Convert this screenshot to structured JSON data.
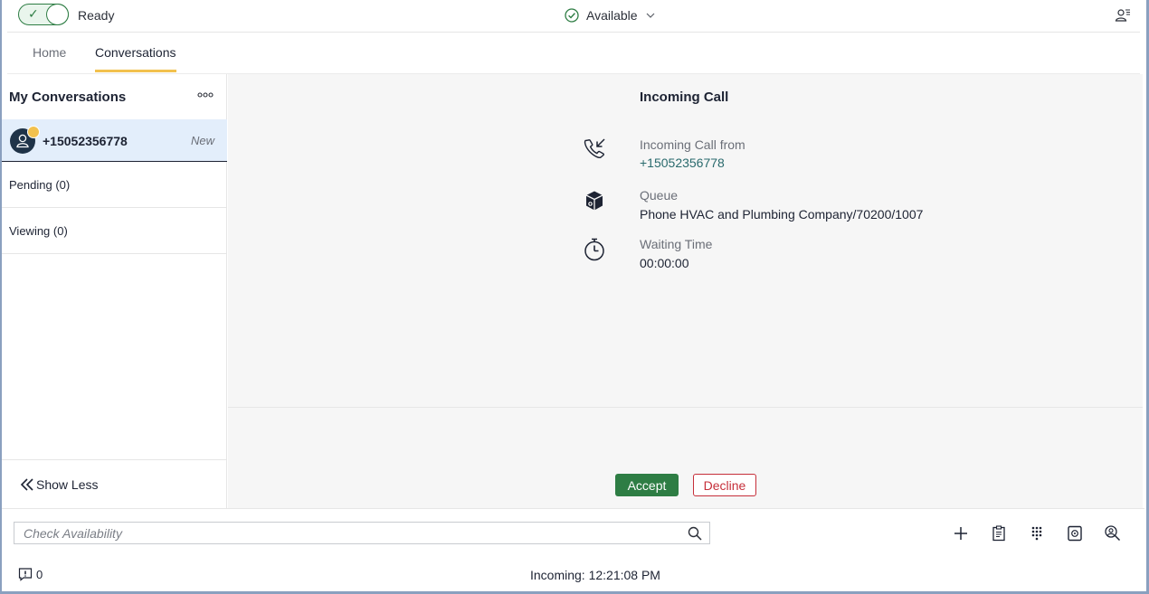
{
  "topbar": {
    "ready_label": "Ready",
    "availability": "Available"
  },
  "tabs": [
    {
      "label": "Home",
      "active": false
    },
    {
      "label": "Conversations",
      "active": true
    }
  ],
  "sidebar": {
    "title": "My Conversations",
    "active_conversation": {
      "number": "+15052356778",
      "tag": "New"
    },
    "pending_label": "Pending (0)",
    "viewing_label": "Viewing (0)",
    "show_less_label": "Show Less"
  },
  "call": {
    "title": "Incoming Call",
    "from_label": "Incoming Call from",
    "from_value": "+15052356778",
    "queue_label": "Queue",
    "queue_value": "Phone HVAC and Plumbing Company/70200/1007",
    "waiting_label": "Waiting Time",
    "waiting_value": "00:00:00",
    "accept_label": "Accept",
    "decline_label": "Decline"
  },
  "footer": {
    "search_placeholder": "Check Availability",
    "notification_count": "0",
    "status_text": "Incoming: 12:21:08 PM"
  },
  "colors": {
    "accent_green": "#2e7d44",
    "decline_red": "#c62f3a",
    "tab_underline": "#f2c14e",
    "selected_row": "#e3eefb",
    "link_teal": "#2a6a6d"
  },
  "icons": {
    "availability": "check-circle-icon",
    "user_menu": "user-list-icon",
    "more": "more-options-icon",
    "from": "incoming-call-icon",
    "queue": "queue-box-icon",
    "waiting": "stopwatch-icon",
    "search": "search-icon",
    "tools": [
      "add-icon",
      "clipboard-icon",
      "dialpad-icon",
      "contact-book-icon",
      "user-search-icon"
    ]
  }
}
